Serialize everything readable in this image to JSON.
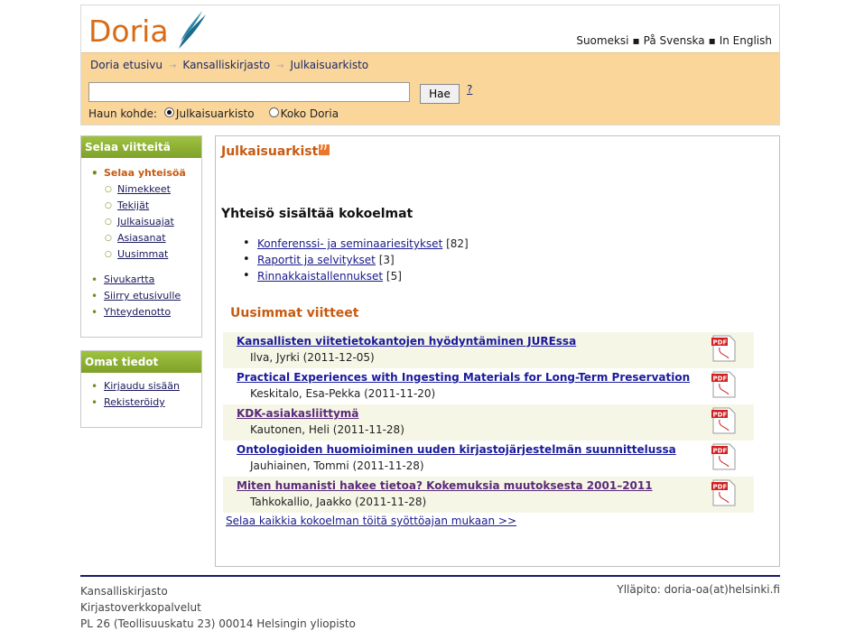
{
  "header": {
    "logo": "Doria",
    "languages": [
      "Suomeksi",
      "På Svenska",
      "In English"
    ],
    "breadcrumbs": [
      "Doria etusivu",
      "Kansalliskirjasto",
      "Julkaisuarkisto"
    ],
    "search": {
      "value": "",
      "button": "Hae",
      "help": "?"
    },
    "scope": {
      "label": "Haun kohde:",
      "options": [
        "Julkaisuarkisto",
        "Koko Doria"
      ],
      "selected": "Julkaisuarkisto"
    }
  },
  "sidebar": {
    "browse": {
      "title": "Selaa viitteitä",
      "active": "Selaa yhteisöä",
      "sub_items": [
        "Nimekkeet",
        "Tekijät",
        "Julkaisuajat",
        "Asiasanat",
        "Uusimmat"
      ],
      "items": [
        "Sivukartta",
        "Siirry etusivulle",
        "Yhteydenotto"
      ]
    },
    "account": {
      "title": "Omat tiedot",
      "items": [
        "Kirjaudu sisään",
        "Rekisteröidy"
      ]
    }
  },
  "main": {
    "title": "Julkaisuarkisto",
    "collections_heading": "Yhteisö sisältää kokoelmat",
    "collections": [
      {
        "name": "Konferenssi- ja seminaariesitykset",
        "count": "[82]"
      },
      {
        "name": "Raportit ja selvitykset",
        "count": "[3]"
      },
      {
        "name": "Rinnakkaistallennukset",
        "count": "[5]"
      }
    ],
    "recent_heading": "Uusimmat viitteet",
    "recent": [
      {
        "title": "Kansallisten viitetietokantojen hyödyntäminen JUREssa",
        "meta": "Ilva, Jyrki (2011-12-05)"
      },
      {
        "title": "Practical Experiences with Ingesting Materials for Long-Term Preservation",
        "meta": "Keskitalo, Esa-Pekka (2011-11-20)"
      },
      {
        "title": "KDK-asiakasliittymä",
        "meta": "Kautonen, Heli (2011-11-28)"
      },
      {
        "title": "Ontologioiden huomioiminen uuden kirjastojärjestelmän suunnittelussa",
        "meta": "Jauhiainen, Tommi (2011-11-28)"
      },
      {
        "title": "Miten humanisti hakee tietoa? Kokemuksia muutoksesta 2001–2011",
        "meta": "Tahkokallio, Jaakko (2011-11-28)"
      }
    ],
    "browse_all": "Selaa kaikkia kokoelman töitä syöttöajan mukaan >>"
  },
  "footer": {
    "lines": [
      "Kansalliskirjasto",
      "Kirjastoverkkopalvelut",
      "PL 26 (Teollisuuskatu 23) 00014 Helsingin yliopisto"
    ],
    "maintainer": "Ylläpito: doria-oa(at)helsinki.fi"
  },
  "colors": {
    "accent": "#c85a10",
    "header_band": "#fbd69a",
    "sidebar_title": "#8fb236",
    "footer_rule": "#1a1a6c"
  },
  "icons": [
    "rss-icon",
    "pdf-icon"
  ]
}
